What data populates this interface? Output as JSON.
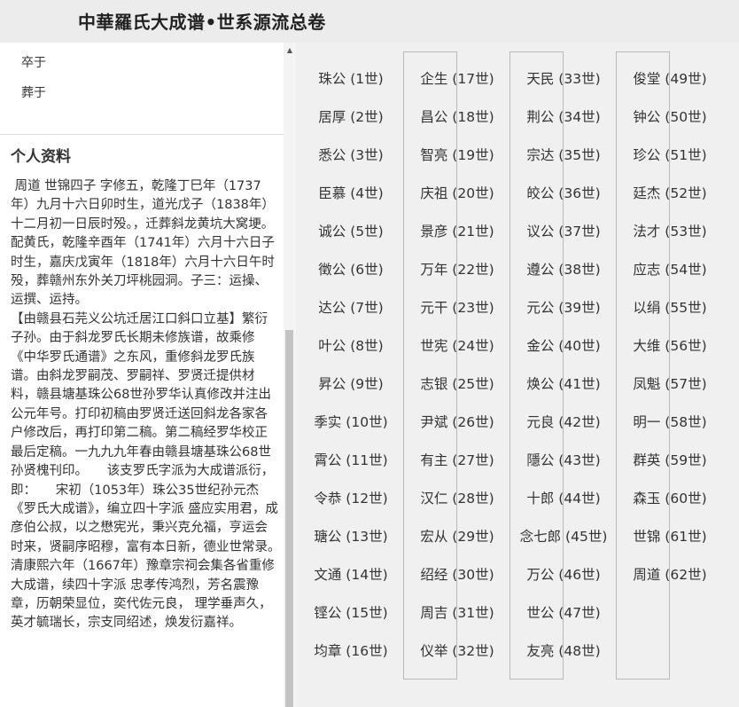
{
  "header": {
    "title": "中華羅氏大成谱•世系源流总卷"
  },
  "record": {
    "death_label": "卒于",
    "burial_label": "葬于"
  },
  "profile": {
    "heading": "个人资料",
    "bio": " 周道 世锦四子 字修五，乾隆丁巳年（1737年）九月十六日卯时生，道光戊子（1838年）十二月初一日辰时殁。，迁葬斜龙黄坑大窝埂。配黄氏，乾隆辛酉年（1741年）六月十六日子时生，嘉庆戊寅年（1818年）六月十六日午时殁，葬赣州东外关刀坪桃园洞。子三：运操、运撰、运持。\n【由赣县石芫义公坑迁居江口斜口立基】繁衍子孙。由于斜龙罗氏长期未修族谱，故乘修《中华罗氏通谱》之东风，重修斜龙罗氏族谱。由斜龙罗嗣茂、罗嗣祥、罗贤迁提供材料，赣县塘基珠公68世孙罗华认真修改并注出公元年号。打印初稿由罗贤迁送回斜龙各家各户修改后，再打印第二稿。第二稿经罗华校正最后定稿。一九九九年春由赣县塘基珠公68世孙贤槐刊印。　　该支罗氏字派为大成谱派衍，即：　　宋初（1053年）珠公35世纪孙元杰《罗氏大成谱》，编立四十字派 盛应实用君，成彦伯公叔，以之懋宪光，秉兴克允福，亨运会时来，贤嗣序昭穆，富有本日新，德业世常录。　　清康熙六年（1667年）豫章宗祠会集各省重修大成谱，续四十字派 忠孝传鸿烈，芳名震豫章，历朝荣显位，奕代佐元良， 理学垂声久，英才毓瑞长，宗支同绍述，焕发衍嘉祥。"
  },
  "generations": {
    "columns": [
      [
        "珠公 (1世)",
        "居厚 (2世)",
        "悉公 (3世)",
        "臣慕 (4世)",
        "诚公 (5世)",
        "徵公 (6世)",
        "达公 (7世)",
        "叶公 (8世)",
        "昇公 (9世)",
        "季实 (10世)",
        "霄公 (11世)",
        "令恭 (12世)",
        "瑭公 (13世)",
        "文通 (14世)",
        "铿公 (15世)",
        "均章 (16世)"
      ],
      [
        "企生 (17世)",
        "昌公 (18世)",
        "智亮 (19世)",
        "庆祖 (20世)",
        "景彦 (21世)",
        "万年 (22世)",
        "元干 (23世)",
        "世宪 (24世)",
        "志银 (25世)",
        "尹斌 (26世)",
        "有主 (27世)",
        "汉仁 (28世)",
        "宏从 (29世)",
        "绍经 (30世)",
        "周吉 (31世)",
        "仪举 (32世)"
      ],
      [
        "天民 (33世)",
        "荆公 (34世)",
        "宗达 (35世)",
        "皎公 (36世)",
        "议公 (37世)",
        "遵公 (38世)",
        "元公 (39世)",
        "金公 (40世)",
        "焕公 (41世)",
        "元良 (42世)",
        "隱公 (43世)",
        "十郎 (44世)",
        "念七郎 (45世)",
        "万公 (46世)",
        "世公 (47世)",
        "友亮 (48世)"
      ],
      [
        "俊堂 (49世)",
        "钟公 (50世)",
        "珍公 (51世)",
        "廷杰 (52世)",
        "法才 (53世)",
        "应志 (54世)",
        "以绢 (55世)",
        "大维 (56世)",
        "凤魁 (57世)",
        "明一 (58世)",
        "群英 (59世)",
        "森玉 (60世)",
        "世锦 (61世)",
        "周道 (62世)"
      ]
    ]
  }
}
